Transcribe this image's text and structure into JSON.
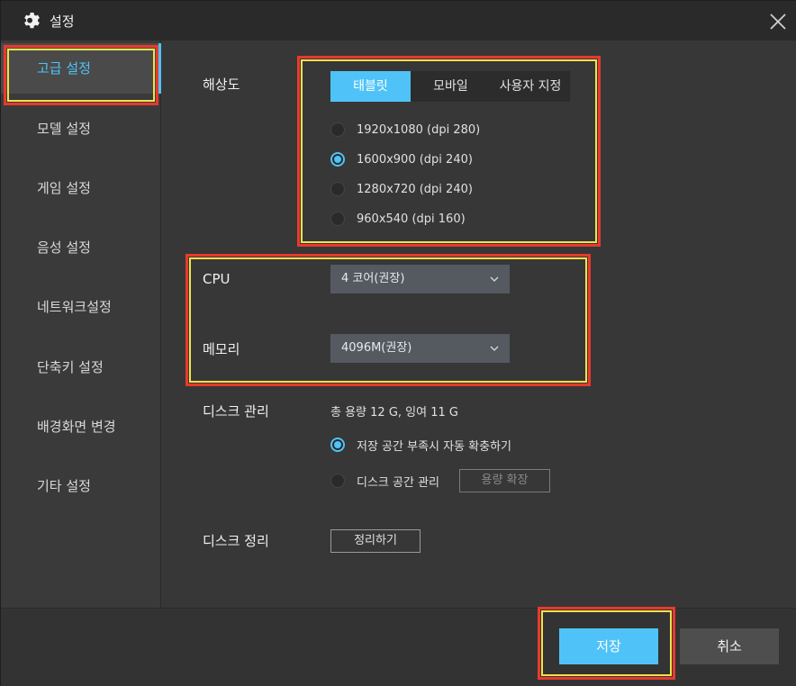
{
  "window": {
    "title": "설정"
  },
  "sidebar": {
    "items": [
      {
        "label": "고급 설정",
        "active": true
      },
      {
        "label": "모델 설정"
      },
      {
        "label": "게임 설정"
      },
      {
        "label": "음성 설정"
      },
      {
        "label": "네트워크설정"
      },
      {
        "label": "단축키 설정"
      },
      {
        "label": "배경화면 변경"
      },
      {
        "label": "기타 설정"
      }
    ]
  },
  "resolution": {
    "label": "해상도",
    "tabs": [
      {
        "label": "태블릿",
        "active": true
      },
      {
        "label": "모바일"
      },
      {
        "label": "사용자 지정"
      }
    ],
    "options": [
      {
        "label": "1920x1080  (dpi 280)"
      },
      {
        "label": "1600x900  (dpi 240)",
        "checked": true
      },
      {
        "label": "1280x720  (dpi 240)"
      },
      {
        "label": "960x540  (dpi 160)"
      }
    ]
  },
  "cpu": {
    "label": "CPU",
    "value": "4 코어(권장)"
  },
  "memory": {
    "label": "메모리",
    "value": "4096M(권장)"
  },
  "disk": {
    "label": "디스크 관리",
    "info": "총 용량 12 G,  잉여 11 G",
    "options": [
      {
        "label": "저장 공간 부족시 자동 확충하기",
        "checked": true
      },
      {
        "label": "디스크 공간 관리"
      }
    ],
    "expand_button": "용량 확장"
  },
  "cleanup": {
    "label": "디스크 정리",
    "button": "정리하기"
  },
  "footer": {
    "save": "저장",
    "cancel": "취소"
  },
  "colors": {
    "accent": "#4fc3f7",
    "highlight_red": "#e8392e",
    "highlight_yellow": "#f2e24a"
  }
}
